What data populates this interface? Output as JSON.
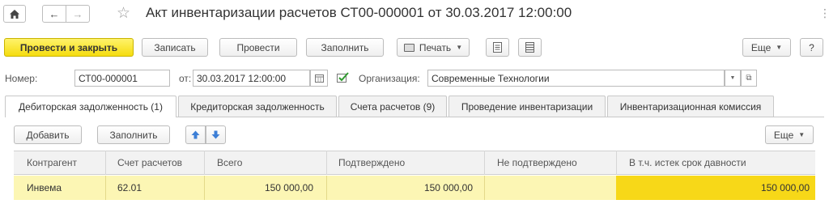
{
  "window": {
    "title": "Акт инвентаризации расчетов СТ00-000001 от 30.03.2017 12:00:00",
    "more_dots": "⋮"
  },
  "toolbar": {
    "post_close": "Провести и закрыть",
    "save": "Записать",
    "post": "Провести",
    "fill": "Заполнить",
    "print": "Печать",
    "more": "Еще",
    "help": "?"
  },
  "form": {
    "number_label": "Номер:",
    "number_value": "СТ00-000001",
    "date_label": "от:",
    "date_value": "30.03.2017 12:00:00",
    "org_label": "Организация:",
    "org_value": "Современные Технологии"
  },
  "tabs": [
    {
      "label": "Дебиторская задолженность (1)",
      "active": true
    },
    {
      "label": "Кредиторская задолженность",
      "active": false
    },
    {
      "label": "Счета расчетов (9)",
      "active": false
    },
    {
      "label": "Проведение инвентаризации",
      "active": false
    },
    {
      "label": "Инвентаризационная комиссия",
      "active": false
    }
  ],
  "table_toolbar": {
    "add": "Добавить",
    "fill": "Заполнить",
    "more": "Еще"
  },
  "table": {
    "columns": [
      "Контрагент",
      "Счет расчетов",
      "Всего",
      "Подтверждено",
      "Не подтверждено",
      "В т.ч. истек срок давности"
    ],
    "rows": [
      {
        "counterparty": "Инвема",
        "account": "62.01",
        "total": "150 000,00",
        "confirmed": "150 000,00",
        "not_confirmed": "",
        "expired": "150 000,00"
      }
    ]
  },
  "colors": {
    "primary_button": "#f5dc0f",
    "row_selected": "#fcf6b4",
    "cell_highlight": "#f7d818"
  }
}
